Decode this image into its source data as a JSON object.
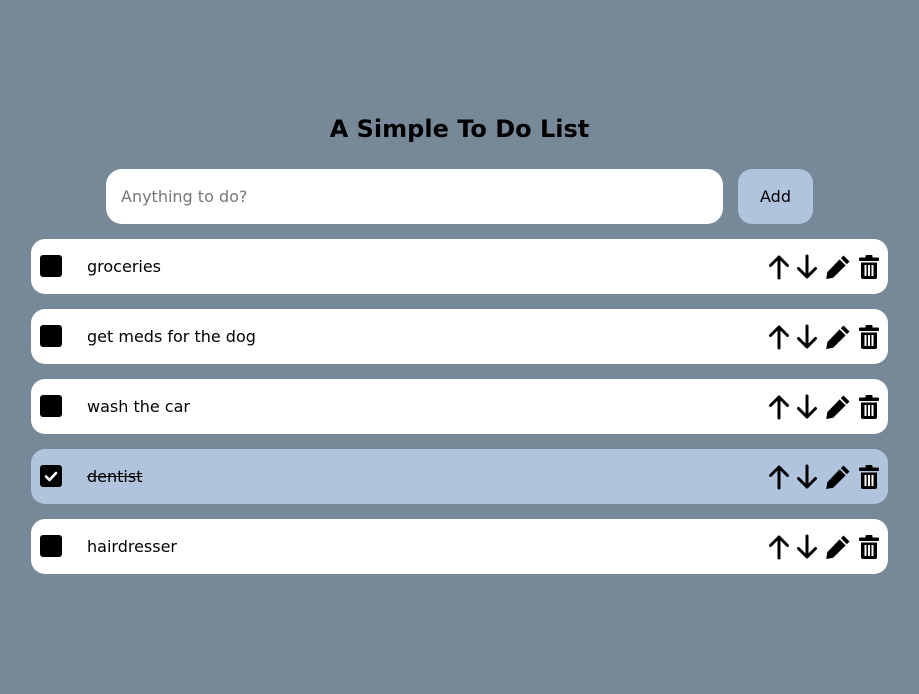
{
  "app": {
    "title": "A Simple To Do List"
  },
  "input": {
    "placeholder": "Anything to do?",
    "value": ""
  },
  "add_button": {
    "label": "Add"
  },
  "colors": {
    "background": "#778899",
    "accent": "#b0c4de",
    "item": "#ffffff"
  },
  "icons": {
    "move_up": "arrow-up-icon",
    "move_down": "arrow-down-icon",
    "edit": "pencil-icon",
    "delete": "trash-icon",
    "check": "checkmark-icon"
  },
  "todos": [
    {
      "text": "groceries",
      "done": false
    },
    {
      "text": "get meds for the dog",
      "done": false
    },
    {
      "text": "wash the car",
      "done": false
    },
    {
      "text": "dentist",
      "done": true
    },
    {
      "text": "hairdresser",
      "done": false
    }
  ]
}
